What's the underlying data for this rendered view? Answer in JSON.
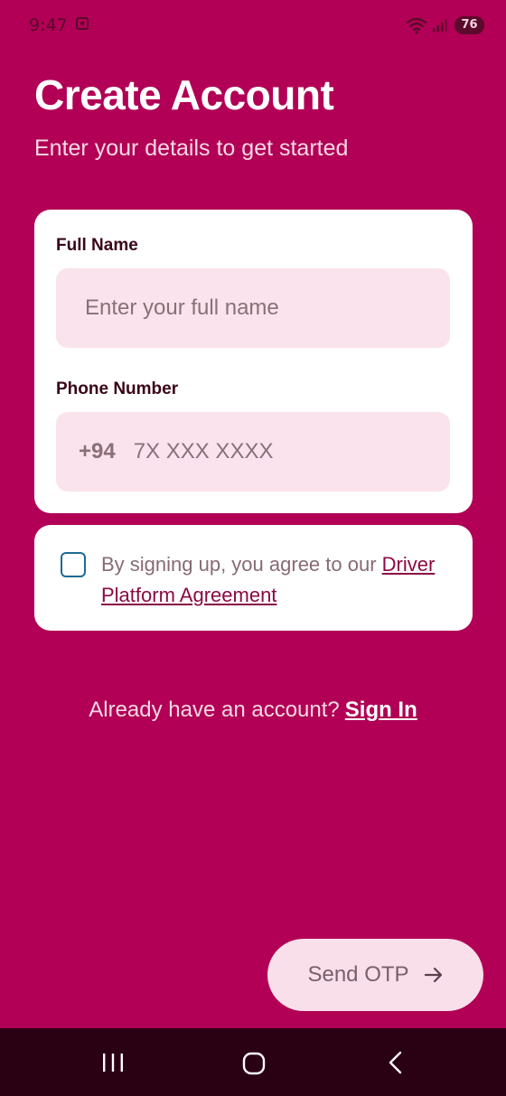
{
  "status_bar": {
    "time": "9:47",
    "battery": "76",
    "icons": [
      "screenshot-icon",
      "wifi-icon",
      "signal-icon"
    ]
  },
  "header": {
    "title": "Create Account",
    "subtitle": "Enter your details to get started"
  },
  "form": {
    "full_name": {
      "label": "Full Name",
      "placeholder": "Enter your full name",
      "value": ""
    },
    "phone": {
      "label": "Phone Number",
      "country_code": "+94",
      "placeholder": "7X XXX XXXX",
      "value": ""
    }
  },
  "terms": {
    "checked": false,
    "text": "By signing up, you agree to our ",
    "link_label": "Driver Platform Agreement"
  },
  "signin": {
    "prompt": "Already have an account?",
    "link_label": "Sign In"
  },
  "send_otp": {
    "label": "Send OTP",
    "icon": "arrow-right-icon"
  },
  "nav": {
    "icons": [
      "recents-icon",
      "home-icon",
      "back-icon"
    ]
  },
  "colors": {
    "background": "#b10055",
    "card": "#ffffff",
    "input": "#fae3ec",
    "checkbox_border": "#1f6a93",
    "nav_bar": "#2a0013"
  }
}
